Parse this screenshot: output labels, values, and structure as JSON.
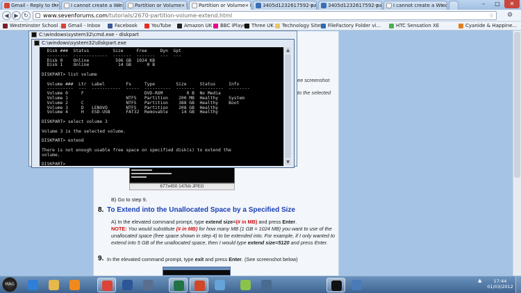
{
  "browser": {
    "tabs": [
      {
        "label": "Gmail - Reply to thread",
        "color": "#d44638"
      },
      {
        "label": "I cannot create a Windo",
        "color": "#f0f0f0"
      },
      {
        "label": "Partition or Volume - Si",
        "color": "#f0f0f0"
      },
      {
        "label": "Partition or Volume - E",
        "color": "#f0f0f0"
      },
      {
        "label": "3405d1232617592-parti",
        "color": "#3a6fb5"
      },
      {
        "label": "3405d1232617592-parti",
        "color": "#3a6fb5"
      },
      {
        "label": "I cannot create a Windo",
        "color": "#f0f0f0"
      }
    ],
    "window_controls": {
      "minimize": "–",
      "maximize": "□",
      "close": "✕"
    },
    "nav": {
      "back": "◀",
      "forward": "▶",
      "reload": "↻"
    },
    "url_domain": "www.sevenforums.com",
    "url_path": "/tutorials/2670-partition-volume-extend.html",
    "star": "☆",
    "wrench": "⚙"
  },
  "bookmarks": [
    {
      "label": "Westminster School ...",
      "color": "#7a1f2b"
    },
    {
      "label": "Gmail - Inbox",
      "color": "#d44638"
    },
    {
      "label": "Facebook",
      "color": "#3b5998"
    },
    {
      "label": "YouTube",
      "color": "#e52d27"
    },
    {
      "label": "Amazon UK",
      "color": "#222222"
    },
    {
      "label": "BBC iPlayer",
      "color": "#ec008c"
    },
    {
      "label": "Three UK",
      "color": "#111111"
    },
    {
      "label": "Technology Sites",
      "color": "#e9c46a"
    },
    {
      "label": "FileFactory Folder vi...",
      "color": "#2d6bb5"
    },
    {
      "label": "HTC Sensation XE",
      "color": "#4caf50"
    },
    {
      "label": "Cyanide & Happine...",
      "color": "#e08020"
    }
  ],
  "page": {
    "side_note_1": "ee screenshot",
    "side_note_2": "to the selected",
    "thumb_caption": "677x450  147kb  JPEG",
    "step_b": "B) Go to step 9.",
    "step8_num": "8.",
    "step8_title": "To Extend into the Unallocated Space by a Specified Size",
    "step8_a_1": "A) In the elevated command prompt, type ",
    "step8_a_cmd": "extend size=",
    "step8_a_param": "(# in MB)",
    "step8_a_2": " and press ",
    "step8_a_enter": "Enter",
    "step8_note_label": "NOTE:",
    "step8_note_1": " You would substitute ",
    "step8_note_param": "(# in MB)",
    "step8_note_2": " for how many MB (1 GB = 1024 MB) you want to use of the unallocated space (free space shown in step 4) to be extended into. For example, if I only wanted to extend into 5 GB of the unallocated space, then I would type ",
    "step8_note_cmd": "extend size=5120",
    "step8_note_3": " and press Enter.",
    "step9_num": "9.",
    "step9_1": "In the elevated command prompt, type ",
    "step9_cmd": "exit",
    "step9_2": " and press ",
    "step9_enter": "Enter",
    "step9_3": ". (See screenshot below)"
  },
  "console_back": {
    "title": "C:\\windows\\system32\\cmd.exe - diskpart"
  },
  "console_front": {
    "title": "C:\\windows\\system32\\diskpart.exe",
    "lines": [
      "  Disk ###  Status         Size     Free     Dyn  Gpt",
      "  --------  -------------  -------  -------  ---  ---",
      "  Disk 0    Online          596 GB  1024 KB",
      "  Disk 1    Online           14 GB      0 B",
      "",
      "DISKPART> list volume",
      "",
      "  Volume ###  Ltr  Label        Fs     Type        Size     Status     Info",
      "  ----------  ---  -----------  -----  ----------  -------  ---------  --------",
      "  Volume 0     F                       DVD-ROM         0 B  No Media",
      "  Volume 1                      NTFS   Partition    200 MB  Healthy    System",
      "  Volume 2     C                NTFS   Partition    388 GB  Healthy    Boot",
      "  Volume 3     D   LENOVO       NTFS   Partition    208 GB  Healthy",
      "  Volume 4     H   ESD-USB      FAT32  Removable     14 GB  Healthy",
      "",
      "DISKPART> select volume 3",
      "",
      "Volume 3 is the selected volume.",
      "",
      "DISKPART> extend",
      "",
      "There is not enough usable free space on specified disk(s) to extend the",
      "volume.",
      "",
      "DISKPART> _"
    ]
  },
  "taskbar": {
    "start_label": "MAG",
    "items": [
      {
        "name": "ie-icon",
        "color": "#2f7ed8",
        "active": false
      },
      {
        "name": "explorer-icon",
        "color": "#e7b84a",
        "active": false
      },
      {
        "name": "media-player-icon",
        "color": "#f08a1c",
        "active": false
      },
      {
        "name": "chrome-icon",
        "color": "#db4437",
        "active": true
      },
      {
        "name": "word-icon",
        "color": "#2b5797",
        "active": false
      },
      {
        "name": "app-icon",
        "color": "#5a6f8f",
        "active": false
      },
      {
        "name": "excel-icon",
        "color": "#217346",
        "active": true
      },
      {
        "name": "powerpoint-icon",
        "color": "#d24726",
        "active": true
      },
      {
        "name": "paint-icon",
        "color": "#66a3d9",
        "active": false
      },
      {
        "name": "itunes-icon",
        "color": "#8bc34a",
        "active": false
      },
      {
        "name": "app2-icon",
        "color": "#4a6b8f",
        "active": false
      },
      {
        "name": "cmd-icon",
        "color": "#111111",
        "active": true
      },
      {
        "name": "app3-icon",
        "color": "#4a7ab8",
        "active": false
      }
    ],
    "time": "17:44",
    "date": "01/03/2012"
  }
}
